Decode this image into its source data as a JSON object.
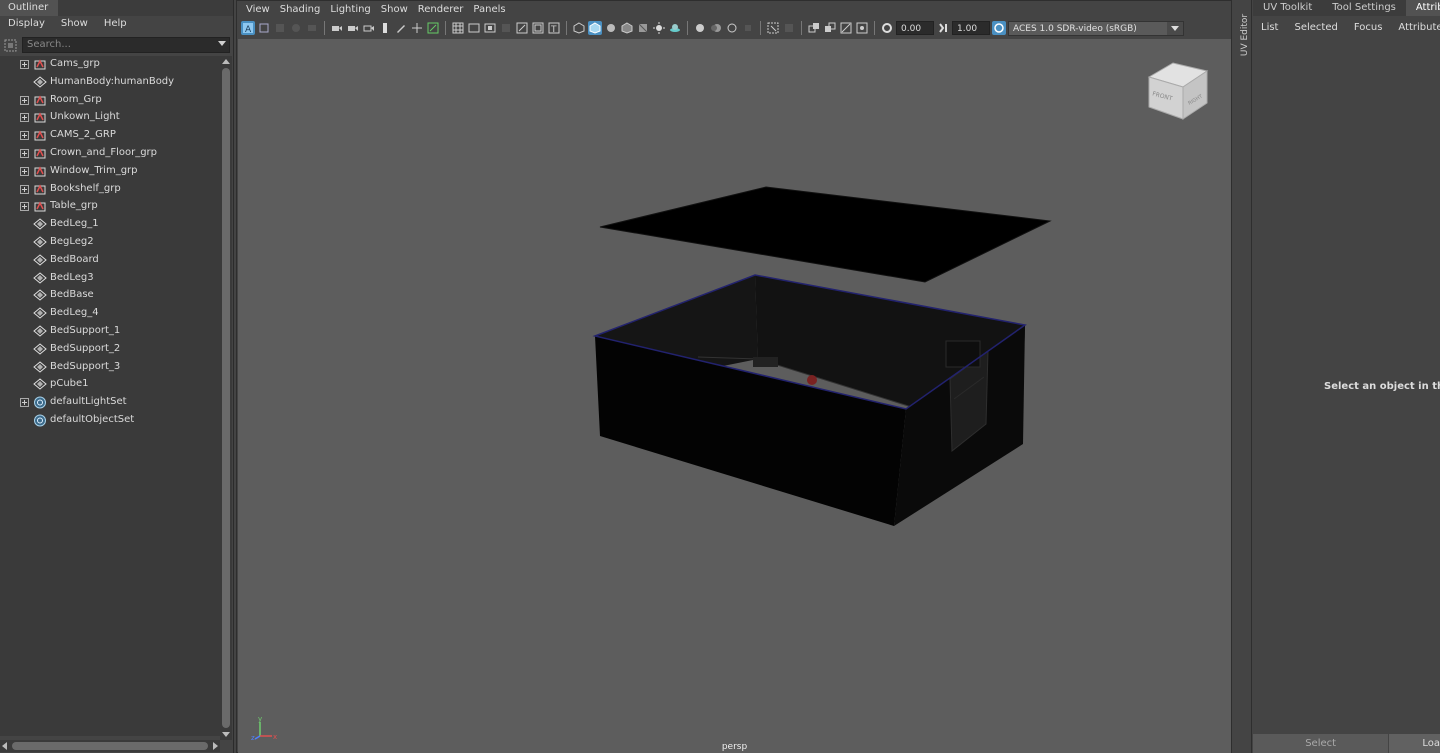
{
  "outliner": {
    "title": "Outliner",
    "menu": [
      "Display",
      "Show",
      "Help"
    ],
    "search_placeholder": "Search...",
    "items": [
      {
        "label": "Cams_grp",
        "type": "group",
        "expandable": true
      },
      {
        "label": "HumanBody:humanBody",
        "type": "mesh",
        "expandable": false
      },
      {
        "label": "Room_Grp",
        "type": "group",
        "expandable": true
      },
      {
        "label": "Unkown_Light",
        "type": "group",
        "expandable": true
      },
      {
        "label": "CAMS_2_GRP",
        "type": "group",
        "expandable": true
      },
      {
        "label": "Crown_and_Floor_grp",
        "type": "group",
        "expandable": true
      },
      {
        "label": "Window_Trim_grp",
        "type": "group",
        "expandable": true
      },
      {
        "label": "Bookshelf_grp",
        "type": "group",
        "expandable": true
      },
      {
        "label": "Table_grp",
        "type": "group",
        "expandable": true
      },
      {
        "label": "BedLeg_1",
        "type": "mesh",
        "expandable": false
      },
      {
        "label": "BegLeg2",
        "type": "mesh",
        "expandable": false
      },
      {
        "label": "BedBoard",
        "type": "mesh",
        "expandable": false
      },
      {
        "label": "BedLeg3",
        "type": "mesh",
        "expandable": false
      },
      {
        "label": "BedBase",
        "type": "mesh",
        "expandable": false
      },
      {
        "label": "BedLeg_4",
        "type": "mesh",
        "expandable": false
      },
      {
        "label": "BedSupport_1",
        "type": "mesh",
        "expandable": false
      },
      {
        "label": "BedSupport_2",
        "type": "mesh",
        "expandable": false
      },
      {
        "label": "BedSupport_3",
        "type": "mesh",
        "expandable": false
      },
      {
        "label": "pCube1",
        "type": "mesh",
        "expandable": false
      },
      {
        "label": "defaultLightSet",
        "type": "set",
        "expandable": true
      },
      {
        "label": "defaultObjectSet",
        "type": "set",
        "expandable": false
      }
    ]
  },
  "viewport": {
    "menu": [
      "View",
      "Shading",
      "Lighting",
      "Show",
      "Renderer",
      "Panels"
    ],
    "exposure": "0.00",
    "gamma": "1.00",
    "color_space": "ACES 1.0 SDR-video (sRGB)",
    "camera": "persp",
    "view_cube": {
      "front": "FRONT",
      "right": "RIGHT"
    },
    "axis": {
      "x": "x",
      "y": "y",
      "z": "z"
    }
  },
  "uv_editor": {
    "label": "UV Editor"
  },
  "attribute_editor": {
    "tabs": [
      "UV Toolkit",
      "Tool Settings",
      "Attrib"
    ],
    "menu": [
      "List",
      "Selected",
      "Focus",
      "Attributes"
    ],
    "message": "Select an object in the sce",
    "footer_select": "Select",
    "footer_load": "Loa"
  },
  "colors": {
    "viewport_bg": "#5d5d5d",
    "panel_bg": "#444444",
    "selection_highlight": "#22226e",
    "active_button": "#4a90c2"
  }
}
